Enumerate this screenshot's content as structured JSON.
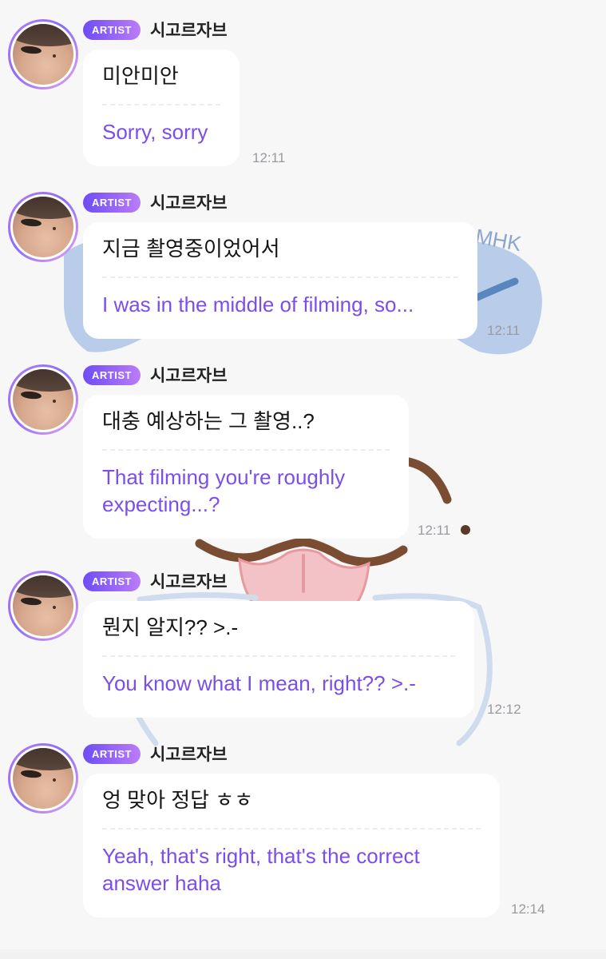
{
  "sender": {
    "badge": "ARTIST",
    "name": "시고르자브"
  },
  "background": {
    "watermark": "MHK"
  },
  "messages": [
    {
      "korean": "미안미안",
      "english": "Sorry, sorry",
      "time": "12:11"
    },
    {
      "korean": "지금 촬영중이었어서",
      "english": "I was in the middle of filming, so...",
      "time": "12:11"
    },
    {
      "korean": "대충 예상하는 그 촬영..?",
      "english": "That filming you're roughly expecting...?",
      "time": "12:11"
    },
    {
      "korean": "뭔지 알지?? >.-",
      "english": "You know what I mean, right?? >.-",
      "time": "12:12"
    },
    {
      "korean": "엉 맞아 정답 ㅎㅎ",
      "english": "Yeah, that's right, that's the correct answer haha",
      "time": "12:14"
    }
  ],
  "colors": {
    "badge_start": "#6e4df4",
    "badge_end": "#bb7cf8",
    "translation_text": "#7c4ee8",
    "background": "#f7f7f8"
  }
}
